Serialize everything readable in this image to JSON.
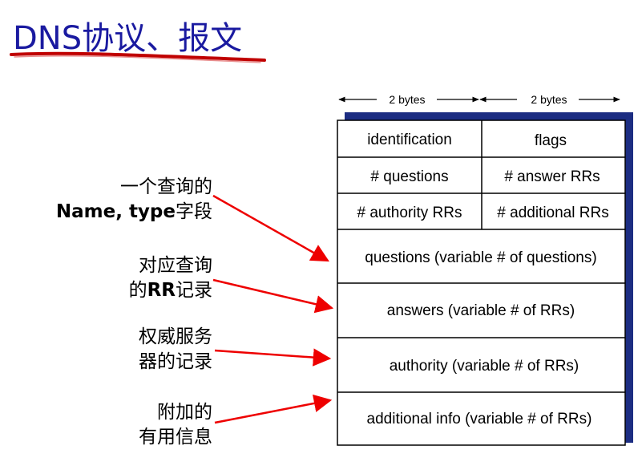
{
  "title": "DNS协议、报文",
  "header": {
    "bytes_left": "2 bytes",
    "bytes_right": "2 bytes"
  },
  "message": {
    "identification": "identification",
    "flags": "flags",
    "questions_count": "# questions",
    "answer_rrs": "# answer RRs",
    "authority_rrs": "# authority RRs",
    "additional_rrs": "# additional RRs",
    "questions": "questions (variable # of questions)",
    "answers": "answers (variable # of RRs)",
    "authority": "authority (variable # of RRs)",
    "additional": "additional info (variable # of RRs)"
  },
  "annotations": {
    "query": {
      "line1": "一个查询的",
      "line2_bold": "Name, type",
      "line2_rest": "字段"
    },
    "answers": {
      "line1": "对应查询",
      "line2_prefix": "的",
      "line2_bold": "RR",
      "line2_rest": "记录"
    },
    "authority": {
      "line1": "权威服务",
      "line2": "器的记录"
    },
    "additional": {
      "line1": "附加的",
      "line2": "有用信息"
    }
  },
  "colors": {
    "title": "#1a1aa0",
    "underline": "#c00000",
    "arrow": "#ee0000",
    "shadow": "#1c2d82"
  }
}
